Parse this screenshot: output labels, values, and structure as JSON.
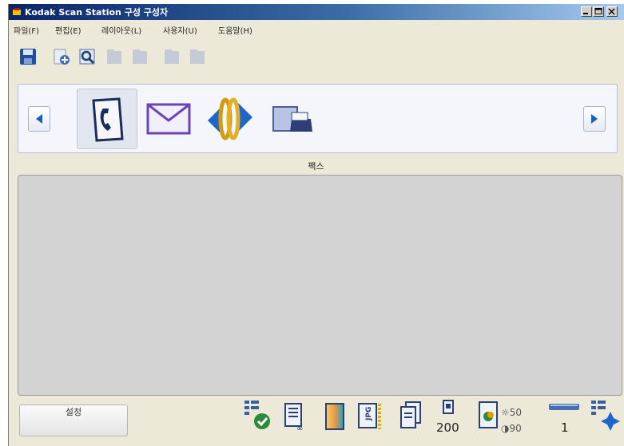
{
  "window": {
    "title": "Kodak Scan Station 구성 구성자",
    "controls": [
      "minimize",
      "maximize",
      "close"
    ]
  },
  "menu": {
    "items": [
      "파일(F)",
      "편집(E)",
      "레이아웃(L)",
      "사용자(U)",
      "도움말(H)"
    ]
  },
  "toolbar": {
    "buttons": [
      {
        "icon": "save-icon",
        "enabled": true
      },
      {
        "icon": "new-document-icon",
        "enabled": true
      },
      {
        "icon": "preview-icon",
        "enabled": true
      },
      {
        "icon": "disabled-tool-icon",
        "enabled": false
      },
      {
        "icon": "disabled-tool-icon",
        "enabled": false
      },
      {
        "icon": "disabled-tool-icon",
        "enabled": false
      },
      {
        "icon": "disabled-tool-icon",
        "enabled": false
      }
    ]
  },
  "destinations": {
    "selected": "fax",
    "items": [
      {
        "id": "fax",
        "icon": "fax-phone-icon"
      },
      {
        "id": "email",
        "icon": "email-envelope-icon"
      },
      {
        "id": "network",
        "icon": "network-rings-icon"
      },
      {
        "id": "printer",
        "icon": "printer-icon"
      }
    ],
    "selected_label": "팩스"
  },
  "bottom": {
    "setup_button_label": "설정",
    "status": {
      "resolution": "200",
      "brightness": "50",
      "contrast": "90",
      "page_count": "1"
    }
  },
  "colors": {
    "title_gradient_start": "#0a246a",
    "title_gradient_end": "#a6caf0",
    "panel_background": "#f4f6fc",
    "preview_background": "#d3d3d3",
    "nav_arrow": "#1a5fb4"
  }
}
